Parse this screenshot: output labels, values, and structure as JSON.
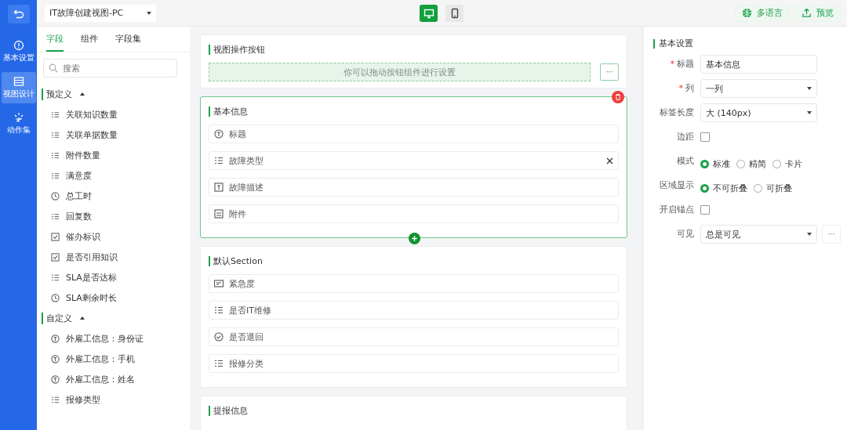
{
  "nav": {
    "items": [
      {
        "label": "基本设置",
        "kind": "info",
        "selected": false
      },
      {
        "label": "视图设计",
        "kind": "layout",
        "selected": true
      },
      {
        "label": "动作集",
        "kind": "spark",
        "selected": false
      }
    ]
  },
  "view_select": {
    "value": "IT故障创建视图-PC"
  },
  "device_toggle": [
    {
      "kind": "desktop",
      "selected": true
    },
    {
      "kind": "mobile",
      "selected": false
    }
  ],
  "top_actions": [
    {
      "label": "多语言",
      "kind": "globe"
    },
    {
      "label": "预览",
      "kind": "upload"
    }
  ],
  "field_tabs": [
    {
      "label": "字段",
      "selected": true
    },
    {
      "label": "组件",
      "selected": false
    },
    {
      "label": "字段集",
      "selected": false
    }
  ],
  "search": {
    "placeholder": "搜索"
  },
  "field_groups": [
    {
      "title": "预定义",
      "expanded": true,
      "items": [
        {
          "label": "关联知识数量",
          "kind": "number"
        },
        {
          "label": "关联单据数量",
          "kind": "number"
        },
        {
          "label": "附件数量",
          "kind": "number"
        },
        {
          "label": "满意度",
          "kind": "number"
        },
        {
          "label": "总工时",
          "kind": "clock"
        },
        {
          "label": "回复数",
          "kind": "number"
        },
        {
          "label": "催办标识",
          "kind": "checkbox"
        },
        {
          "label": "是否引用知识",
          "kind": "checkbox"
        },
        {
          "label": "SLA是否达标",
          "kind": "list"
        },
        {
          "label": "SLA剩余时长",
          "kind": "clock"
        }
      ]
    },
    {
      "title": "自定义",
      "expanded": true,
      "items": [
        {
          "label": "外雇工信息：身份证",
          "kind": "text"
        },
        {
          "label": "外雇工信息：手机",
          "kind": "text"
        },
        {
          "label": "外雇工信息：姓名",
          "kind": "text"
        },
        {
          "label": "报修类型",
          "kind": "list"
        }
      ]
    }
  ],
  "action_bar": {
    "title": "视图操作按钮",
    "placeholder": "你可以拖动按钮组件进行设置",
    "more": "···"
  },
  "sections": [
    {
      "title": "基本信息",
      "selected": true,
      "fields": [
        {
          "label": "标题",
          "kind": "text",
          "removable": false
        },
        {
          "label": "故障类型",
          "kind": "list",
          "removable": true
        },
        {
          "label": "故障描述",
          "kind": "textarea",
          "removable": false
        },
        {
          "label": "附件",
          "kind": "image",
          "removable": false
        }
      ]
    },
    {
      "title": "默认Section",
      "selected": false,
      "fields": [
        {
          "label": "紧急度",
          "kind": "tag",
          "removable": false
        },
        {
          "label": "是否IT维修",
          "kind": "list",
          "removable": false
        },
        {
          "label": "是否退回",
          "kind": "check",
          "removable": false
        },
        {
          "label": "报修分类",
          "kind": "list",
          "removable": false
        }
      ]
    },
    {
      "title": "提报信息",
      "selected": false
    }
  ],
  "settings": {
    "title": "基本设置",
    "rows": [
      {
        "label": "标题",
        "kind": "input",
        "marker": "*",
        "value": "基本信息"
      },
      {
        "label": "列",
        "kind": "select",
        "marker": "*",
        "value": "一列"
      },
      {
        "label": "标签长度",
        "kind": "select",
        "value": "大 (140px)"
      },
      {
        "label": "边距",
        "kind": "checkbox",
        "checked": false
      },
      {
        "label": "模式",
        "kind": "radio",
        "options": [
          {
            "label": "标准",
            "selected": true
          },
          {
            "label": "精简",
            "selected": false
          },
          {
            "label": "卡片",
            "selected": false
          }
        ]
      },
      {
        "label": "区域显示",
        "kind": "radio",
        "options": [
          {
            "label": "不可折叠",
            "selected": true
          },
          {
            "label": "可折叠",
            "selected": false
          }
        ]
      },
      {
        "label": "开启锚点",
        "kind": "checkbox",
        "checked": false
      },
      {
        "label": "可见",
        "kind": "select",
        "value": "总是可见",
        "more": "···"
      }
    ]
  }
}
